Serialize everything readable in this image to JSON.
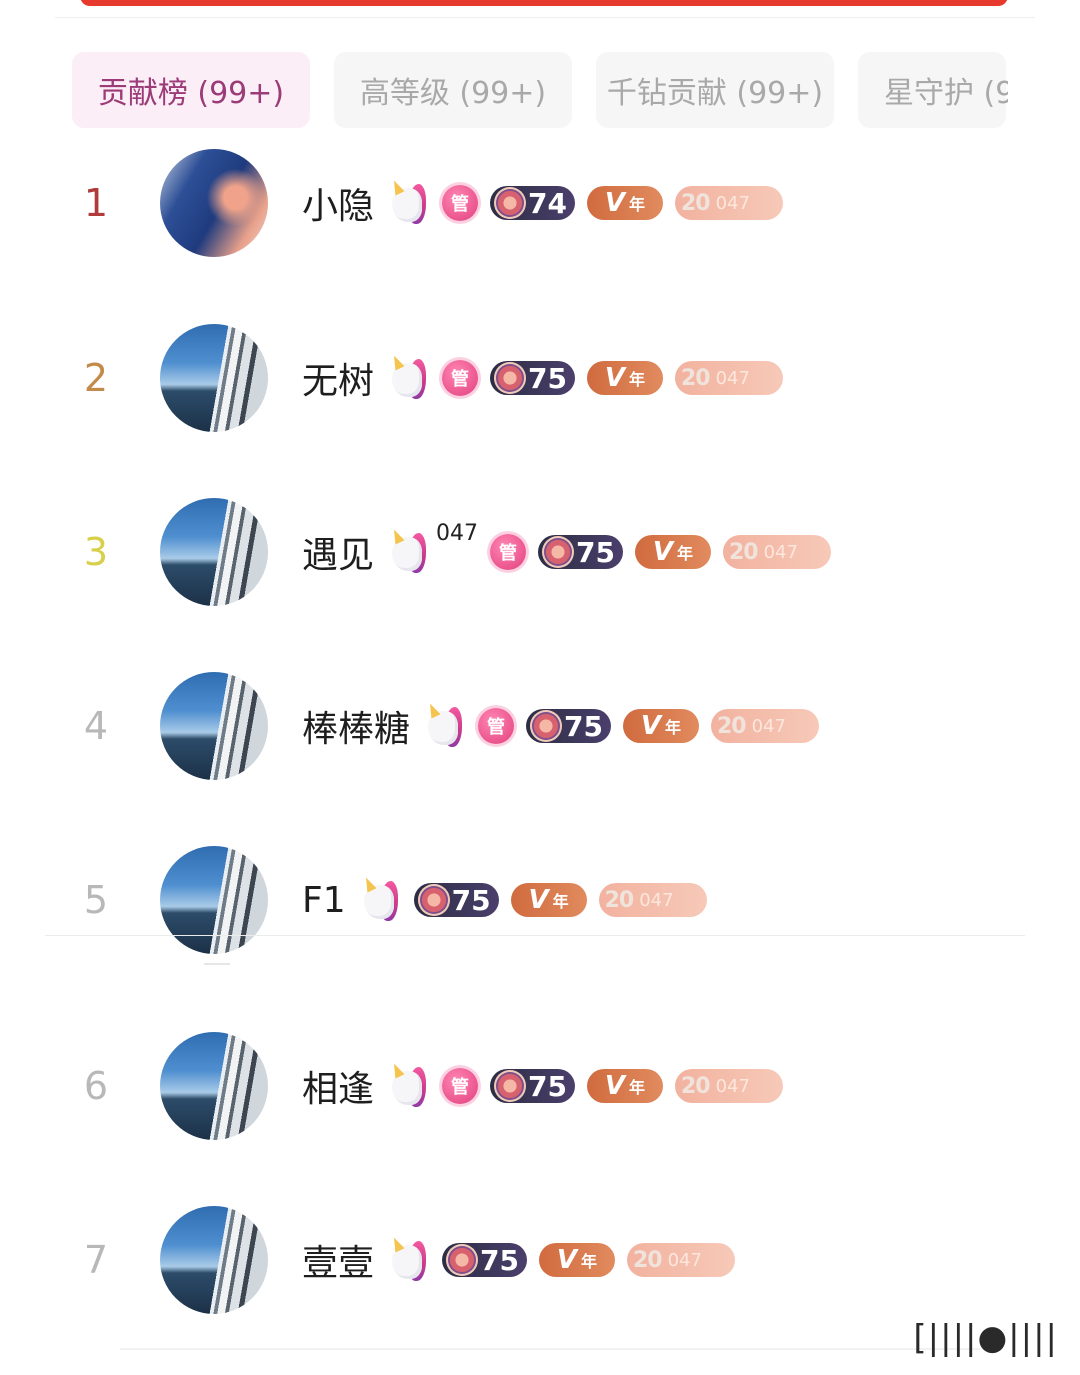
{
  "tabs": [
    {
      "label": "贡献榜 (99+)",
      "active": true
    },
    {
      "label": "高等级 (99+)",
      "active": false
    },
    {
      "label": "千钻贡献 (99+)",
      "active": false
    },
    {
      "label": "星守护 (9",
      "active": false
    }
  ],
  "badge_text": {
    "guan": "管",
    "vip_v": "V",
    "vip_nian": "年",
    "fan_level": "20",
    "fan_club": "047"
  },
  "ranking": [
    {
      "rank": "1",
      "name": "小隐",
      "sup": "",
      "guan": true,
      "level": "74"
    },
    {
      "rank": "2",
      "name": "无树",
      "sup": "",
      "guan": true,
      "level": "75"
    },
    {
      "rank": "3",
      "name": "遇见",
      "sup": "047",
      "guan": true,
      "level": "75"
    },
    {
      "rank": "4",
      "name": "棒棒糖",
      "sup": "",
      "guan": true,
      "level": "75"
    },
    {
      "rank": "5",
      "name": "F1",
      "sup": "",
      "guan": false,
      "level": "75"
    },
    {
      "rank": "6",
      "name": "相逢",
      "sup": "",
      "guan": true,
      "level": "75"
    },
    {
      "rank": "7",
      "name": "壹壹",
      "sup": "",
      "guan": false,
      "level": "75"
    }
  ],
  "watermark": "[||||●||||"
}
